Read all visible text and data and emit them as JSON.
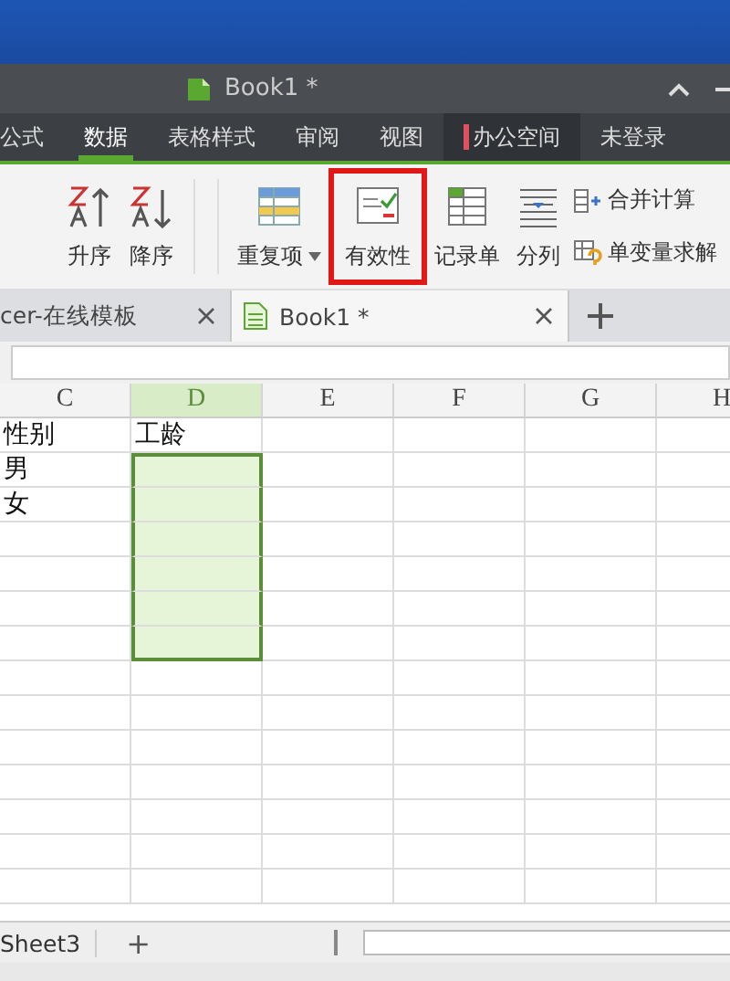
{
  "window": {
    "title": "Book1 *"
  },
  "menu_tabs": [
    {
      "label": "公式",
      "selected": false,
      "kind": "plain"
    },
    {
      "label": "数据",
      "selected": true,
      "kind": "plain"
    },
    {
      "label": "表格样式",
      "selected": false,
      "kind": "plain"
    },
    {
      "label": "审阅",
      "selected": false,
      "kind": "plain"
    },
    {
      "label": "视图",
      "selected": false,
      "kind": "plain"
    },
    {
      "label": "办公空间",
      "selected": false,
      "kind": "space"
    },
    {
      "label": "未登录",
      "selected": false,
      "kind": "plain"
    }
  ],
  "ribbon": [
    {
      "kind": "sort-asc",
      "label": "升序",
      "highlighted": false
    },
    {
      "kind": "sort-desc",
      "label": "降序",
      "highlighted": false
    },
    {
      "kind": "duplicates",
      "label": "重复项",
      "highlighted": false
    },
    {
      "kind": "validity",
      "label": "有效性",
      "highlighted": true
    },
    {
      "kind": "form",
      "label": "记录单",
      "highlighted": false
    },
    {
      "kind": "split",
      "label": "分列",
      "highlighted": false
    }
  ],
  "ribbon_small": [
    {
      "kind": "merge",
      "label": "合并计算"
    },
    {
      "kind": "solve",
      "label": "单变量求解"
    }
  ],
  "doc_tabs": [
    {
      "label": "cer-在线模板",
      "selected": false
    },
    {
      "label": "Book1 *",
      "selected": true
    }
  ],
  "columns": [
    {
      "label": "C",
      "selected": false
    },
    {
      "label": "D",
      "selected": true
    },
    {
      "label": "E",
      "selected": false
    },
    {
      "label": "F",
      "selected": false
    },
    {
      "label": "G",
      "selected": false
    },
    {
      "label": "H",
      "selected": false
    }
  ],
  "rows": [
    {
      "cells": [
        {
          "text": "性别",
          "selected": false
        },
        {
          "text": "工龄",
          "selected": false
        },
        {
          "selected": false
        },
        {
          "selected": false
        },
        {
          "selected": false
        },
        {
          "selected": false
        }
      ]
    },
    {
      "cells": [
        {
          "text": "男",
          "selected": false
        },
        {
          "selected": true
        },
        {
          "selected": false
        },
        {
          "selected": false
        },
        {
          "selected": false
        },
        {
          "selected": false
        }
      ]
    },
    {
      "cells": [
        {
          "text": "女",
          "selected": false
        },
        {
          "selected": true
        },
        {
          "selected": false
        },
        {
          "selected": false
        },
        {
          "selected": false
        },
        {
          "selected": false
        }
      ]
    },
    {
      "cells": [
        {
          "selected": false
        },
        {
          "selected": true
        },
        {
          "selected": false
        },
        {
          "selected": false
        },
        {
          "selected": false
        },
        {
          "selected": false
        }
      ]
    },
    {
      "cells": [
        {
          "selected": false
        },
        {
          "selected": true
        },
        {
          "selected": false
        },
        {
          "selected": false
        },
        {
          "selected": false
        },
        {
          "selected": false
        }
      ]
    },
    {
      "cells": [
        {
          "selected": false
        },
        {
          "selected": true
        },
        {
          "selected": false
        },
        {
          "selected": false
        },
        {
          "selected": false
        },
        {
          "selected": false
        }
      ]
    },
    {
      "cells": [
        {
          "selected": false
        },
        {
          "selected": true
        },
        {
          "selected": false
        },
        {
          "selected": false
        },
        {
          "selected": false
        },
        {
          "selected": false
        }
      ]
    },
    {
      "cells": [
        {
          "selected": false
        },
        {
          "selected": false
        },
        {
          "selected": false
        },
        {
          "selected": false
        },
        {
          "selected": false
        },
        {
          "selected": false
        }
      ]
    },
    {
      "cells": [
        {
          "selected": false
        },
        {
          "selected": false
        },
        {
          "selected": false
        },
        {
          "selected": false
        },
        {
          "selected": false
        },
        {
          "selected": false
        }
      ]
    },
    {
      "cells": [
        {
          "selected": false
        },
        {
          "selected": false
        },
        {
          "selected": false
        },
        {
          "selected": false
        },
        {
          "selected": false
        },
        {
          "selected": false
        }
      ]
    },
    {
      "cells": [
        {
          "selected": false
        },
        {
          "selected": false
        },
        {
          "selected": false
        },
        {
          "selected": false
        },
        {
          "selected": false
        },
        {
          "selected": false
        }
      ]
    },
    {
      "cells": [
        {
          "selected": false
        },
        {
          "selected": false
        },
        {
          "selected": false
        },
        {
          "selected": false
        },
        {
          "selected": false
        },
        {
          "selected": false
        }
      ]
    },
    {
      "cells": [
        {
          "selected": false
        },
        {
          "selected": false
        },
        {
          "selected": false
        },
        {
          "selected": false
        },
        {
          "selected": false
        },
        {
          "selected": false
        }
      ]
    },
    {
      "cells": [
        {
          "selected": false
        },
        {
          "selected": false
        },
        {
          "selected": false
        },
        {
          "selected": false
        },
        {
          "selected": false
        },
        {
          "selected": false
        }
      ]
    }
  ],
  "sheet_bar": {
    "sheet": "Sheet3",
    "add": "+"
  }
}
